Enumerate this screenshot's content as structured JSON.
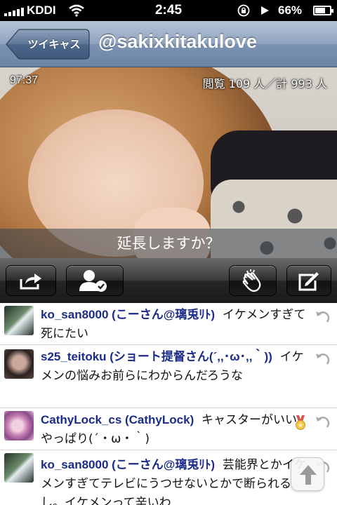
{
  "status_bar": {
    "carrier": "KDDI",
    "time": "2:45",
    "battery": "66%"
  },
  "nav": {
    "back_label": "ツイキャス",
    "title": "@sakixkitakulove"
  },
  "video": {
    "elapsed": "97:37",
    "viewers": "閲覧 109 人／計 993 人",
    "extend_prompt": "延長しますか？"
  },
  "toolbar": {
    "icons": [
      "share-icon",
      "follow-user-icon",
      "clap-icon",
      "compose-icon"
    ]
  },
  "comments": [
    {
      "user": "ko_san8000 (こーさん@璃兎ﾘﾄ)",
      "text": "イケメンすぎて死にたい"
    },
    {
      "user": "s25_teitoku (ショート提督さん(´,,･ω･,,｀))",
      "text": "イケメンの悩みお前らにわからんだろうな"
    },
    {
      "user": "CathyLock_cs (CathyLock)",
      "text": "キャスターがいいやっぱり(´・ω・｀)"
    },
    {
      "user": "ko_san8000 (こーさん@璃兎ﾘﾄ)",
      "text": "芸能界とかイケメンすぎてテレビにうつせないとかで断られるし。イケメンって辛いわ"
    }
  ],
  "colors": {
    "username": "#1a2b8a",
    "nav_gradient_top": "#b6c4d6",
    "nav_gradient_bottom": "#6c84a6"
  }
}
